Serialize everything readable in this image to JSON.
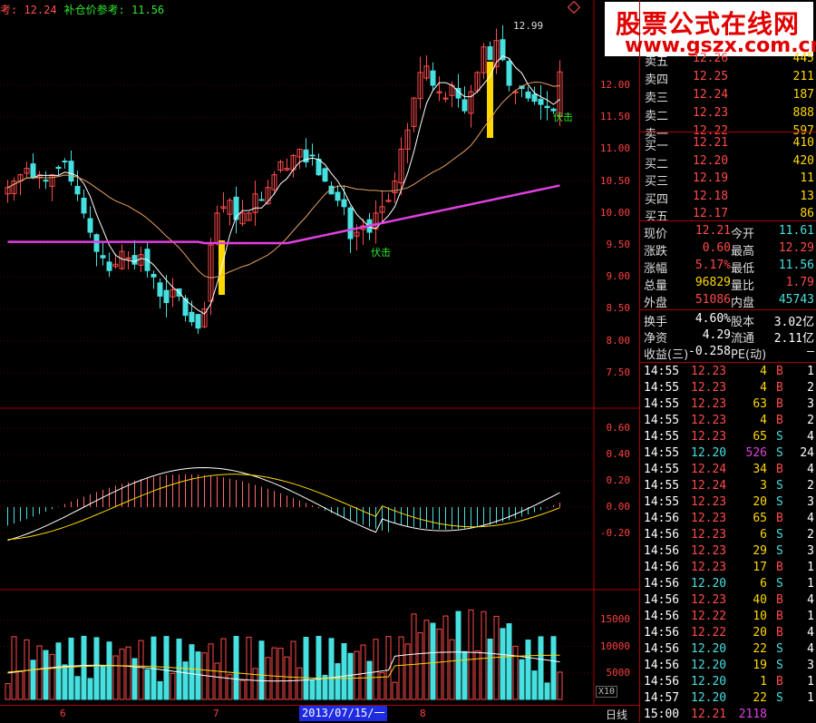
{
  "topbar": {
    "ref_label": "考: 12.24",
    "add_label": "补仓价参考: 11.56"
  },
  "logo": {
    "line1": "股票公式在线网",
    "line2": "www.gszx.com.cn"
  },
  "price_axis": [
    "12.00",
    "11.50",
    "11.00",
    "10.50",
    "10.00",
    "9.50",
    "9.00",
    "8.50",
    "8.00",
    "7.50"
  ],
  "macd_axis": [
    "0.60",
    "0.40",
    "0.20",
    "0.00",
    "-0.20"
  ],
  "vol_axis": [
    "15000",
    "10000",
    "5000"
  ],
  "annotations": {
    "high": "12.99",
    "signal1": "伏击",
    "signal2": "伏击"
  },
  "bottom": {
    "date": "2013/07/15/一",
    "ticks": [
      "6",
      "7",
      "8"
    ],
    "scale": "X10",
    "period": "日线"
  },
  "orderbook": {
    "asks": [
      {
        "label": "卖五",
        "price": "12.26",
        "vol": "445"
      },
      {
        "label": "卖四",
        "price": "12.25",
        "vol": "211"
      },
      {
        "label": "卖三",
        "price": "12.24",
        "vol": "187"
      },
      {
        "label": "卖二",
        "price": "12.23",
        "vol": "888"
      },
      {
        "label": "卖一",
        "price": "12.22",
        "vol": "597"
      }
    ],
    "bids": [
      {
        "label": "买一",
        "price": "12.21",
        "vol": "410"
      },
      {
        "label": "买二",
        "price": "12.20",
        "vol": "420"
      },
      {
        "label": "买三",
        "price": "12.19",
        "vol": "11"
      },
      {
        "label": "买四",
        "price": "12.18",
        "vol": "13"
      },
      {
        "label": "买五",
        "price": "12.17",
        "vol": "86"
      }
    ]
  },
  "quote": {
    "rows": [
      {
        "l1": "现价",
        "v1": "12.21",
        "l2": "今开",
        "v2": "11.61"
      },
      {
        "l1": "涨跌",
        "v1": "0.60",
        "l2": "最高",
        "v2": "12.29"
      },
      {
        "l1": "涨幅",
        "v1": "5.17%",
        "l2": "最低",
        "v2": "11.56"
      },
      {
        "l1": "总量",
        "v1": "96829",
        "l2": "量比",
        "v2": "1.79"
      },
      {
        "l1": "外盘",
        "v1": "51086",
        "l2": "内盘",
        "v2": "45743"
      }
    ]
  },
  "fundamentals": {
    "rows": [
      {
        "l1": "换手",
        "v1": "4.60%",
        "l2": "股本",
        "v2": "3.02亿"
      },
      {
        "l1": "净资",
        "v1": "4.29",
        "l2": "流通",
        "v2": "2.11亿"
      },
      {
        "l1": "收益(三)",
        "v1": "-0.258",
        "l2": "PE(动)",
        "v2": "—"
      }
    ]
  },
  "ticks": [
    {
      "t": "14:55",
      "p": "12.23",
      "v": "4",
      "s": "B",
      "n": "1"
    },
    {
      "t": "14:55",
      "p": "12.23",
      "v": "4",
      "s": "B",
      "n": "2"
    },
    {
      "t": "14:55",
      "p": "12.23",
      "v": "63",
      "s": "B",
      "n": "3"
    },
    {
      "t": "14:55",
      "p": "12.23",
      "v": "4",
      "s": "B",
      "n": "2"
    },
    {
      "t": "14:55",
      "p": "12.23",
      "v": "65",
      "s": "S",
      "n": "4"
    },
    {
      "t": "14:55",
      "p": "12.20",
      "v": "526",
      "s": "S",
      "n": "24"
    },
    {
      "t": "14:55",
      "p": "12.24",
      "v": "34",
      "s": "B",
      "n": "4"
    },
    {
      "t": "14:55",
      "p": "12.24",
      "v": "3",
      "s": "S",
      "n": "2"
    },
    {
      "t": "14:55",
      "p": "12.23",
      "v": "20",
      "s": "S",
      "n": "3"
    },
    {
      "t": "14:56",
      "p": "12.23",
      "v": "65",
      "s": "B",
      "n": "4"
    },
    {
      "t": "14:56",
      "p": "12.23",
      "v": "6",
      "s": "S",
      "n": "2"
    },
    {
      "t": "14:56",
      "p": "12.23",
      "v": "29",
      "s": "S",
      "n": "3"
    },
    {
      "t": "14:56",
      "p": "12.23",
      "v": "17",
      "s": "B",
      "n": "1"
    },
    {
      "t": "14:56",
      "p": "12.20",
      "v": "6",
      "s": "S",
      "n": "1"
    },
    {
      "t": "14:56",
      "p": "12.23",
      "v": "40",
      "s": "B",
      "n": "4"
    },
    {
      "t": "14:56",
      "p": "12.22",
      "v": "10",
      "s": "B",
      "n": "1"
    },
    {
      "t": "14:56",
      "p": "12.22",
      "v": "20",
      "s": "B",
      "n": "4"
    },
    {
      "t": "14:56",
      "p": "12.20",
      "v": "22",
      "s": "S",
      "n": "4"
    },
    {
      "t": "14:56",
      "p": "12.20",
      "v": "19",
      "s": "S",
      "n": "3"
    },
    {
      "t": "14:56",
      "p": "12.20",
      "v": "1",
      "s": "B",
      "n": "1"
    },
    {
      "t": "14:57",
      "p": "12.20",
      "v": "22",
      "s": "S",
      "n": "1"
    },
    {
      "t": "15:00",
      "p": "12.21",
      "v": "2118",
      "s": "",
      "n": ""
    }
  ],
  "colors": {
    "up": "#ff4a4a",
    "down": "#46e0e0",
    "ma_long": "#e040e0",
    "signal": "#ffd800"
  }
}
